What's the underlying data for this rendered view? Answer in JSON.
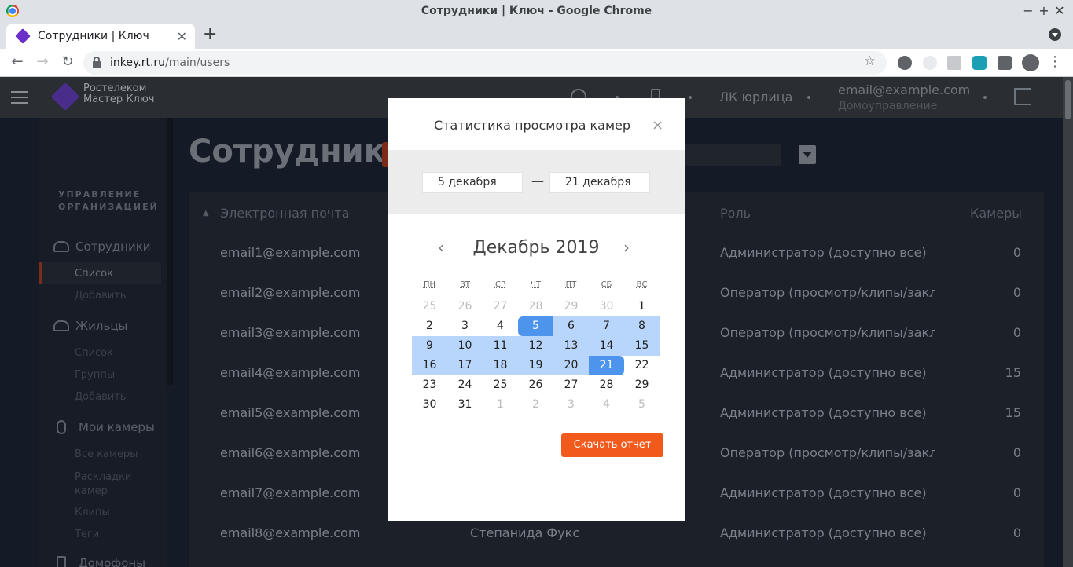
{
  "window": {
    "title": "Сотрудники | Ключ - Google Chrome",
    "controls": [
      "−",
      "+",
      "✕"
    ]
  },
  "tab": {
    "title": "Сотрудники | Ключ",
    "close": "✕",
    "new_tab": "+"
  },
  "toolbar": {
    "back": "←",
    "forward": "→",
    "reload": "↻",
    "url_host": "inkey.rt.ru",
    "url_path": "/main/users",
    "star": "☆"
  },
  "app_header": {
    "brand_line1": "Ростелеком",
    "brand_line2": "Мастер Ключ",
    "account_type": "ЛК юрлица",
    "email": "email@example.com",
    "org": "Домоуправление"
  },
  "sidebar": {
    "heading_line1": "УПРАВЛЕНИЕ",
    "heading_line2": "ОРГАНИЗАЦИЕЙ",
    "employees": {
      "title": "Сотрудники",
      "items": [
        "Список",
        "Добавить"
      ]
    },
    "residents": {
      "title": "Жильцы",
      "items": [
        "Список",
        "Группы",
        "Добавить"
      ]
    },
    "cameras": {
      "title": "Мои камеры",
      "items": [
        "Все камеры",
        "Раскладки камер",
        "Клипы",
        "Теги"
      ]
    },
    "intercoms": {
      "title": "Домофоны"
    }
  },
  "page": {
    "title": "Сотрудники"
  },
  "table": {
    "headers": {
      "sort_icon": "▲",
      "email": "Электронная почта",
      "role": "Роль",
      "cameras": "Камеры"
    },
    "rows": [
      {
        "email": "email1@example.com",
        "name": "",
        "role": "Администратор (доступно все)",
        "cameras": "0"
      },
      {
        "email": "email2@example.com",
        "name": "",
        "role": "Оператор (просмотр/клипы/закл",
        "cameras": "0"
      },
      {
        "email": "email3@example.com",
        "name": "",
        "role": "Оператор (просмотр/клипы/закл",
        "cameras": "0"
      },
      {
        "email": "email4@example.com",
        "name": "",
        "role": "Администратор (доступно все)",
        "cameras": "15"
      },
      {
        "email": "email5@example.com",
        "name": "",
        "role": "Администратор (доступно все)",
        "cameras": "15"
      },
      {
        "email": "email6@example.com",
        "name": "",
        "role": "Оператор (просмотр/клипы/закл",
        "cameras": "0"
      },
      {
        "email": "email7@example.com",
        "name": "",
        "role": "Администратор (доступно все)",
        "cameras": "0"
      },
      {
        "email": "email8@example.com",
        "name": "Степанида Фукс",
        "role": "Администратор (доступно все)",
        "cameras": "0"
      }
    ]
  },
  "modal": {
    "title": "Статистика просмотра камер",
    "close": "×",
    "date_from": "5 декабря",
    "date_separator": "—",
    "date_to": "21 декабря",
    "calendar": {
      "prev": "‹",
      "next": "›",
      "month_title": "Декабрь 2019",
      "weekdays": [
        "ПН",
        "ВТ",
        "СР",
        "ЧТ",
        "ПТ",
        "СБ",
        "ВС"
      ],
      "days": [
        [
          "25",
          "26",
          "27",
          "28",
          "29",
          "30",
          "1"
        ],
        [
          "2",
          "3",
          "4",
          "5",
          "6",
          "7",
          "8"
        ],
        [
          "9",
          "10",
          "11",
          "12",
          "13",
          "14",
          "15"
        ],
        [
          "16",
          "17",
          "18",
          "19",
          "20",
          "21",
          "22"
        ],
        [
          "23",
          "24",
          "25",
          "26",
          "27",
          "28",
          "29"
        ],
        [
          "30",
          "31",
          "1",
          "2",
          "3",
          "4",
          "5"
        ]
      ]
    },
    "download_button": "Скачать отчет"
  }
}
